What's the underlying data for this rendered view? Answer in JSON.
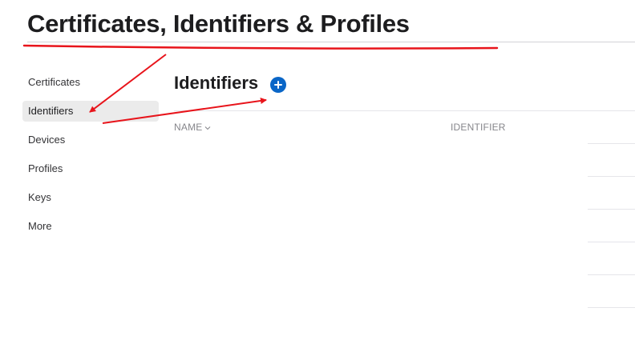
{
  "header": {
    "title": "Certificates, Identifiers & Profiles"
  },
  "sidebar": {
    "items": [
      {
        "label": "Certificates",
        "active": false
      },
      {
        "label": "Identifiers",
        "active": true
      },
      {
        "label": "Devices",
        "active": false
      },
      {
        "label": "Profiles",
        "active": false
      },
      {
        "label": "Keys",
        "active": false
      },
      {
        "label": "More",
        "active": false
      }
    ]
  },
  "main": {
    "section_title": "Identifiers",
    "add_icon": "plus-circle-icon",
    "table": {
      "columns": [
        {
          "label": "NAME",
          "sortable": true
        },
        {
          "label": "IDENTIFIER",
          "sortable": false
        }
      ],
      "rows": []
    }
  },
  "annotations": {
    "color": "#e8141b",
    "arrows": [
      "title-underline",
      "arrow-to-identifiers-item",
      "arrow-to-add-button"
    ]
  },
  "colors": {
    "accent": "#0a66c7",
    "active_item_bg": "#ebebeb",
    "muted_text": "#86868b"
  }
}
